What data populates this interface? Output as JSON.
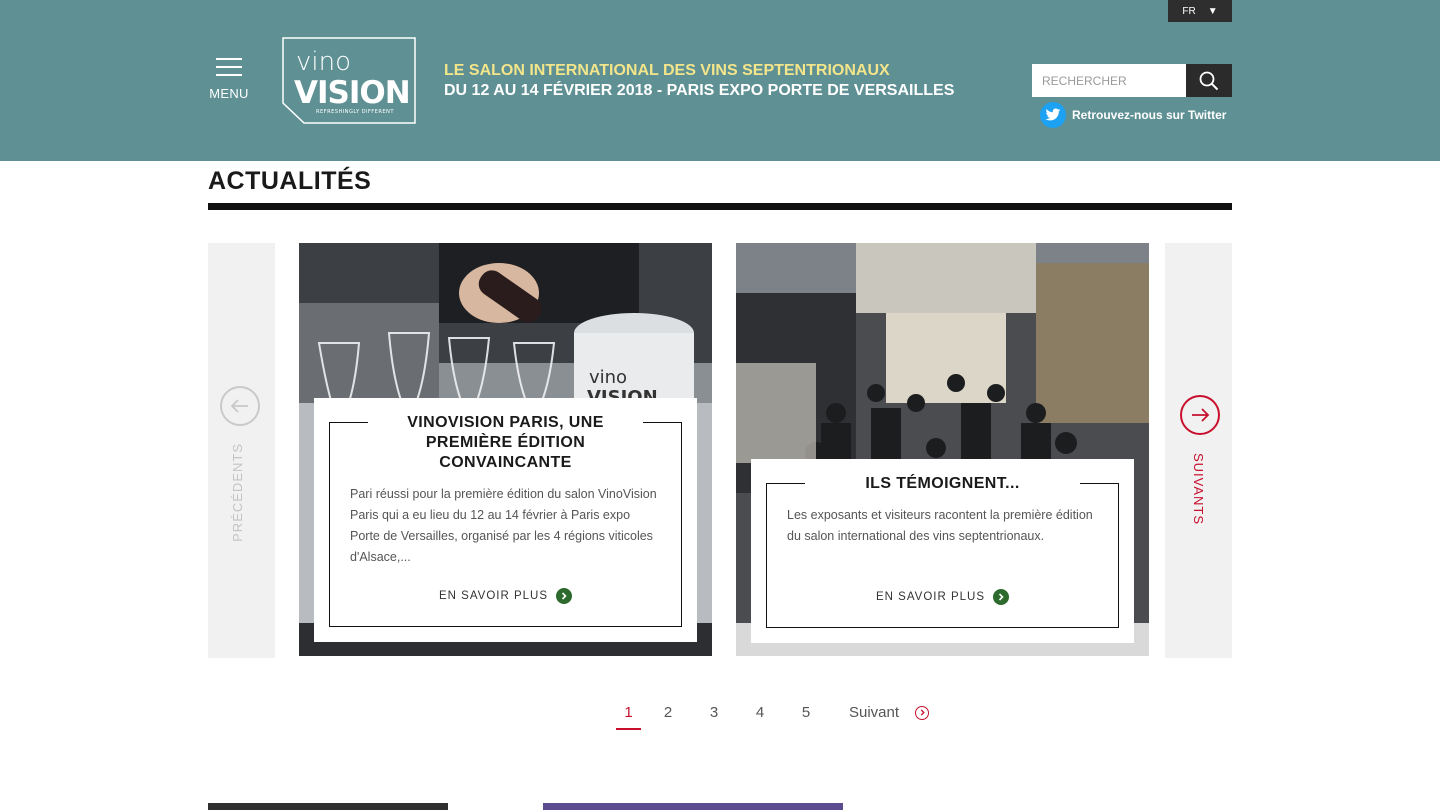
{
  "header": {
    "language": "FR",
    "menu_label": "MENU",
    "logo": {
      "line1": "vino",
      "line2": "VISION",
      "slogan": "REFRESHINGLY DIFFERENT"
    },
    "tagline_line1": "LE SALON INTERNATIONAL DES VINS SEPTENTRIONAUX",
    "tagline_line2": "DU 12 AU 14 FÉVRIER 2018 - PARIS EXPO PORTE DE VERSAILLES",
    "search_placeholder": "RECHERCHER",
    "twitter_label": "Retrouvez-nous sur Twitter"
  },
  "section": {
    "title": "ACTUALITÉS"
  },
  "carousel": {
    "prev_label": "PRÉCÉDENTS",
    "next_label": "SUIVANTS",
    "cards": [
      {
        "title": "VINOVISION PARIS, UNE PREMIÈRE ÉDITION CONVAINCANTE",
        "text": "Pari réussi pour la première édition du salon VinoVision Paris qui a eu lieu du 12 au 14 février à Paris expo Porte de Versailles, organisé par les 4 régions viticoles d'Alsace,...",
        "more": "EN SAVOIR PLUS"
      },
      {
        "title": "ILS TÉMOIGNENT...",
        "text": "Les exposants et visiteurs racontent la première édition du salon international des vins septentrionaux.",
        "more": "EN SAVOIR PLUS"
      }
    ]
  },
  "pagination": {
    "pages": [
      "1",
      "2",
      "3",
      "4",
      "5"
    ],
    "active": "1",
    "next_label": "Suivant"
  },
  "colors": {
    "header_bg": "#5e9094",
    "accent_red": "#c8102e",
    "tagline_yellow": "#f3e58a",
    "go_green": "#2d6a2e"
  }
}
